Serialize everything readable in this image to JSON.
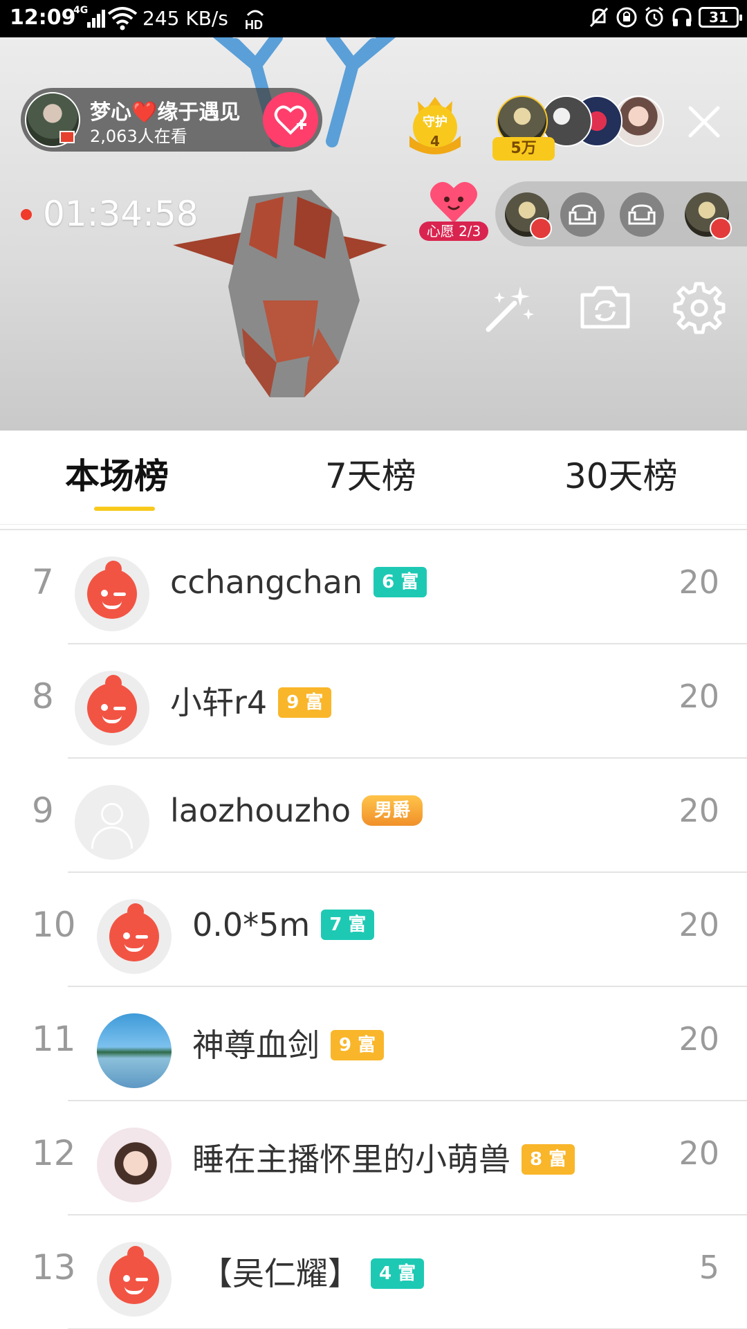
{
  "status_bar": {
    "time": "12:09",
    "network": "4G",
    "speed": "245 KB/s",
    "battery": "31"
  },
  "live": {
    "host_name": "梦心❤️缘于遇见",
    "viewers": "2,063人在看",
    "guard_label": "守护",
    "guard_count": "4",
    "top_gift": "5万",
    "timer": "01:34:58",
    "wish_label": "心愿 2/3"
  },
  "tabs": [
    {
      "label": "本场榜",
      "active": true
    },
    {
      "label": "7天榜",
      "active": false
    },
    {
      "label": "30天榜",
      "active": false
    }
  ],
  "ranking": [
    {
      "rank": "7",
      "name": "cchangchan",
      "badge": "6 富",
      "badge_color": "#1ec9b4",
      "score": "20",
      "avatar": "default"
    },
    {
      "rank": "8",
      "name": "小轩r4",
      "badge": "9 富",
      "badge_color": "#f9b62a",
      "score": "20",
      "avatar": "default"
    },
    {
      "rank": "9",
      "name": "laozhouzho",
      "badge": "男爵",
      "badge_color": "#f0902a",
      "score": "20",
      "avatar": "blank"
    },
    {
      "rank": "10",
      "name": "0.0*5m",
      "badge": "7 富",
      "badge_color": "#1ec9b4",
      "score": "20",
      "avatar": "default"
    },
    {
      "rank": "11",
      "name": "神尊血剑",
      "badge": "9 富",
      "badge_color": "#f9b62a",
      "score": "20",
      "avatar": "lake-photo"
    },
    {
      "rank": "12",
      "name": "睡在主播怀里的小萌兽",
      "badge": "8 富",
      "badge_color": "#f9b62a",
      "score": "20",
      "avatar": "girl-photo"
    },
    {
      "rank": "13",
      "name": "【吴仁耀】",
      "badge": "4 富",
      "badge_color": "#1ec9b4",
      "score": "5",
      "avatar": "default"
    }
  ]
}
